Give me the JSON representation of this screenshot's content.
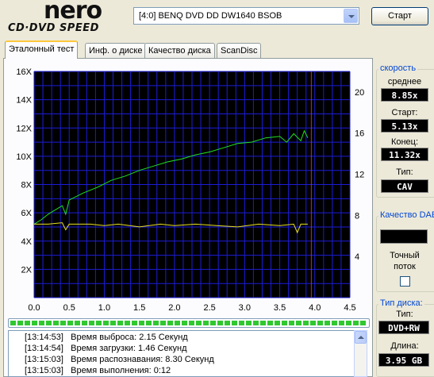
{
  "header": {
    "logo_main": "nero",
    "logo_sub": "CD·DVD SPEED",
    "drive": "[4:0]  BENQ DVD DD DW1640 BSOB",
    "start_label": "Старт"
  },
  "tabs": [
    {
      "label": "Эталонный тест",
      "active": true
    },
    {
      "label": "Инф. о диске",
      "active": false
    },
    {
      "label": "Качество диска",
      "active": false
    },
    {
      "label": "ScanDisc",
      "active": false
    }
  ],
  "speed": {
    "title": "скорость",
    "avg_label": "среднее",
    "avg_value": "8.85x",
    "start_label": "Старт:",
    "start_value": "5.13x",
    "end_label": "Конец:",
    "end_value": "11.32x",
    "type_label": "Тип:",
    "type_value": "CAV"
  },
  "dae": {
    "title": "Качество DAE",
    "accurate_label_1": "Точный",
    "accurate_label_2": "поток"
  },
  "disc": {
    "title": "Тип диска:",
    "type_label": "Тип:",
    "type_value": "DVD+RW",
    "length_label": "Длина:",
    "length_value": "3.95 GB"
  },
  "progress": {
    "fraction": 1.0
  },
  "log": [
    {
      "time": "[13:14:53]",
      "text": "Время выброса: 2.15 Секунд"
    },
    {
      "time": "[13:14:54]",
      "text": "Время загрузки: 1.46 Секунд"
    },
    {
      "time": "[13:15:03]",
      "text": "Время распознавания: 8.30 Секунд"
    },
    {
      "time": "[13:15:03]",
      "text": "Время выполнения:  0:12"
    }
  ],
  "chart_data": {
    "type": "line",
    "xlabel": "",
    "xlim": [
      0,
      4.5
    ],
    "xticks": [
      "0.0",
      "0.5",
      "1.0",
      "1.5",
      "2.0",
      "2.5",
      "3.0",
      "3.5",
      "4.0",
      "4.5"
    ],
    "ylim_left": [
      0,
      16
    ],
    "yticks_left": [
      "2X",
      "4X",
      "6X",
      "8X",
      "10X",
      "12X",
      "14X",
      "16X"
    ],
    "ylim_right": [
      0,
      22
    ],
    "yticks_right": [
      "4",
      "8",
      "12",
      "16",
      "20"
    ],
    "marker_x": 3.95,
    "colors": {
      "background": "#000000",
      "grid": "#1c1cd8",
      "read_speed": "#22e022",
      "spin": "#e8e020",
      "marker": "#c03030"
    },
    "series": [
      {
        "name": "",
        "color": "#22e022",
        "x": [
          0.0,
          0.1,
          0.2,
          0.3,
          0.4,
          0.45,
          0.5,
          0.7,
          0.9,
          1.1,
          1.3,
          1.5,
          1.7,
          1.9,
          2.1,
          2.3,
          2.5,
          2.7,
          2.9,
          3.1,
          3.3,
          3.5,
          3.6,
          3.7,
          3.8,
          3.85,
          3.9
        ],
        "y": [
          5.2,
          5.5,
          5.9,
          6.2,
          6.5,
          5.9,
          6.9,
          7.4,
          7.8,
          8.3,
          8.6,
          9.0,
          9.3,
          9.6,
          9.8,
          10.1,
          10.3,
          10.6,
          10.9,
          11.0,
          11.3,
          11.4,
          11.0,
          11.6,
          11.1,
          11.8,
          11.3
        ]
      },
      {
        "name": "",
        "color": "#e8e020",
        "x": [
          0.0,
          0.2,
          0.4,
          0.45,
          0.5,
          0.8,
          1.0,
          1.2,
          1.5,
          1.8,
          2.0,
          2.3,
          2.6,
          2.9,
          3.2,
          3.5,
          3.7,
          3.75,
          3.8,
          3.9
        ],
        "y": [
          5.2,
          5.2,
          5.3,
          4.8,
          5.2,
          5.2,
          5.1,
          5.2,
          5.0,
          5.2,
          5.1,
          5.2,
          5.1,
          5.0,
          5.2,
          5.1,
          5.2,
          4.6,
          5.2,
          5.2
        ]
      }
    ]
  }
}
